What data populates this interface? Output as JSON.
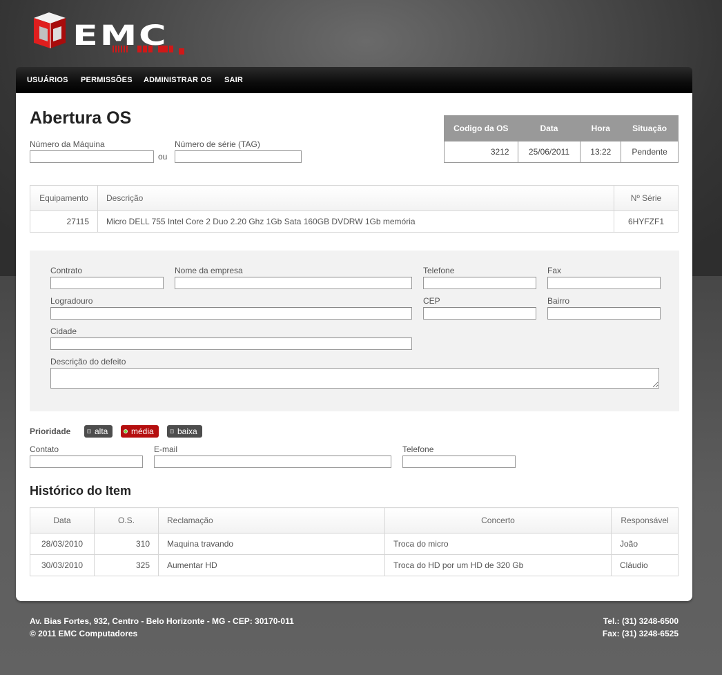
{
  "brand": {
    "logo_text": "EMC"
  },
  "nav": [
    "USUÁRIOS",
    "PERMISSÕES",
    "ADMINISTRAR OS",
    "SAIR"
  ],
  "page_title": "Abertura OS",
  "machine": {
    "numero_label": "Número da Máquina",
    "numero_value": "",
    "ou": "ou",
    "serie_label": "Número de série (TAG)",
    "serie_value": ""
  },
  "os_info": {
    "headers": [
      "Codigo da OS",
      "Data",
      "Hora",
      "Situação"
    ],
    "codigo": "3212",
    "data": "25/06/2011",
    "hora": "13:22",
    "situacao": "Pendente"
  },
  "equipment": {
    "headers": [
      "Equipamento",
      "Descrição",
      "Nº Série"
    ],
    "equipamento": "27115",
    "descricao": "Micro DELL 755 Intel Core 2 Duo 2.20 Ghz 1Gb Sata 160GB DVDRW 1Gb memória",
    "serie": "6HYFZF1"
  },
  "form": {
    "contrato": "Contrato",
    "empresa": "Nome da empresa",
    "telefone": "Telefone",
    "fax": "Fax",
    "logradouro": "Logradouro",
    "cep": "CEP",
    "bairro": "Bairro",
    "cidade": "Cidade",
    "defeito": "Descrição do defeito"
  },
  "prioridade": {
    "label": "Prioridade",
    "options": [
      "alta",
      "média",
      "baixa"
    ],
    "selected": "média"
  },
  "contact": {
    "contato": "Contato",
    "email": "E-mail",
    "telefone": "Telefone"
  },
  "history": {
    "title": "Histórico do Item",
    "headers": [
      "Data",
      "O.S.",
      "Reclamação",
      "Concerto",
      "Responsável"
    ],
    "rows": [
      [
        "28/03/2010",
        "310",
        "Maquina travando",
        "Troca do micro",
        "João"
      ],
      [
        "30/03/2010",
        "325",
        "Aumentar HD",
        "Troca do HD por um HD de 320 Gb",
        "Cláudio"
      ]
    ]
  },
  "footer": {
    "address": "Av. Bias Fortes, 932, Centro - Belo Horizonte - MG - CEP: 30170-011",
    "copyright": "© 2011 EMC Computadores",
    "tel": "Tel.: (31) 3248-6500",
    "fax": "Fax: (31) 3248-6525"
  },
  "colors": {
    "accent": "#b50f0f",
    "nav_bg": "#000000",
    "header_gray": "#999999"
  }
}
